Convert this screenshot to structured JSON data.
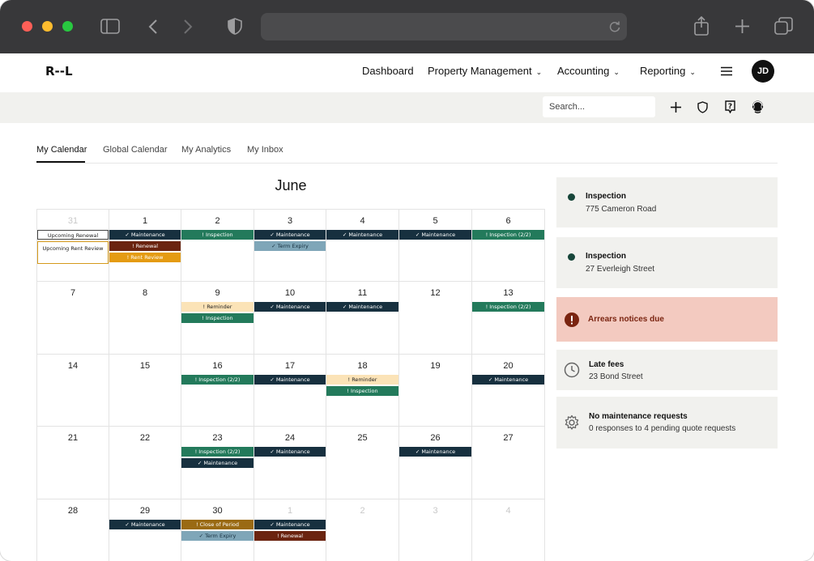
{
  "app": {
    "logo": "R--L",
    "nav": [
      {
        "label": "Dashboard",
        "has_menu": false
      },
      {
        "label": "Property Management",
        "has_menu": true
      },
      {
        "label": "Accounting",
        "has_menu": true
      },
      {
        "label": "Reporting",
        "has_menu": true
      }
    ],
    "user_initials": "JD"
  },
  "toolbar": {
    "search_placeholder": "Search...",
    "icons": [
      "plus-icon",
      "shield-icon",
      "help-icon",
      "support-icon"
    ]
  },
  "tabs": [
    {
      "label": "My Calendar",
      "active": true
    },
    {
      "label": "Global Calendar",
      "active": false
    },
    {
      "label": "My Analytics",
      "active": false
    },
    {
      "label": "My Inbox",
      "active": false
    }
  ],
  "calendar": {
    "month": "June",
    "weeks": [
      [
        {
          "day": "31",
          "muted": true,
          "events": [
            {
              "label": "Upcoming Renewal",
              "type": "outline"
            },
            {
              "label": "Upcoming Rent Review",
              "type": "outline-orange"
            }
          ]
        },
        {
          "day": "1",
          "events": [
            {
              "label": "✓ Maintenance",
              "type": "maintenance"
            },
            {
              "label": "! Renewal",
              "type": "renewal"
            },
            {
              "label": "! Rent Review",
              "type": "rentreview"
            }
          ]
        },
        {
          "day": "2",
          "events": [
            {
              "label": "! Inspection",
              "type": "inspection"
            }
          ]
        },
        {
          "day": "3",
          "events": [
            {
              "label": "✓ Maintenance",
              "type": "maintenance"
            },
            {
              "label": "✓ Term Expiry",
              "type": "termexpiry"
            }
          ]
        },
        {
          "day": "4",
          "events": [
            {
              "label": "✓ Maintenance",
              "type": "maintenance"
            }
          ]
        },
        {
          "day": "5",
          "events": [
            {
              "label": "✓ Maintenance",
              "type": "maintenance"
            }
          ]
        },
        {
          "day": "6",
          "events": [
            {
              "label": "! Inspection (2/2)",
              "type": "inspection"
            }
          ]
        }
      ],
      [
        {
          "day": "7",
          "events": []
        },
        {
          "day": "8",
          "events": []
        },
        {
          "day": "9",
          "events": [
            {
              "label": "! Reminder",
              "type": "reminder"
            },
            {
              "label": "! Inspection",
              "type": "inspection"
            }
          ]
        },
        {
          "day": "10",
          "events": [
            {
              "label": "✓ Maintenance",
              "type": "maintenance"
            }
          ]
        },
        {
          "day": "11",
          "events": [
            {
              "label": "✓ Maintenance",
              "type": "maintenance"
            }
          ]
        },
        {
          "day": "12",
          "events": []
        },
        {
          "day": "13",
          "events": [
            {
              "label": "! Inspection (2/2)",
              "type": "inspection"
            }
          ]
        }
      ],
      [
        {
          "day": "14",
          "events": []
        },
        {
          "day": "15",
          "events": []
        },
        {
          "day": "16",
          "events": [
            {
              "label": "! Inspection (2/2)",
              "type": "inspection"
            }
          ]
        },
        {
          "day": "17",
          "events": [
            {
              "label": "✓ Maintenance",
              "type": "maintenance"
            }
          ]
        },
        {
          "day": "18",
          "events": [
            {
              "label": "! Reminder",
              "type": "reminder"
            },
            {
              "label": "! Inspection",
              "type": "inspection"
            }
          ]
        },
        {
          "day": "19",
          "events": []
        },
        {
          "day": "20",
          "events": [
            {
              "label": "✓ Maintenance",
              "type": "maintenance"
            }
          ]
        }
      ],
      [
        {
          "day": "21",
          "events": []
        },
        {
          "day": "22",
          "events": []
        },
        {
          "day": "23",
          "events": [
            {
              "label": "! Inspection (2/2)",
              "type": "inspection"
            },
            {
              "label": "✓ Maintenance",
              "type": "maintenance"
            }
          ]
        },
        {
          "day": "24",
          "events": [
            {
              "label": "✓ Maintenance",
              "type": "maintenance"
            }
          ]
        },
        {
          "day": "25",
          "events": []
        },
        {
          "day": "26",
          "events": [
            {
              "label": "✓ Maintenance",
              "type": "maintenance"
            }
          ]
        },
        {
          "day": "27",
          "events": []
        }
      ],
      [
        {
          "day": "28",
          "events": []
        },
        {
          "day": "29",
          "events": [
            {
              "label": "✓ Maintenance",
              "type": "maintenance"
            }
          ]
        },
        {
          "day": "30",
          "events": [
            {
              "label": "! Close of Period",
              "type": "closeperiod"
            },
            {
              "label": "✓ Term Expiry",
              "type": "termexpiry"
            }
          ]
        },
        {
          "day": "1",
          "muted": true,
          "events": [
            {
              "label": "✓ Maintenance",
              "type": "maintenance"
            },
            {
              "label": "! Renewal",
              "type": "renewal"
            }
          ]
        },
        {
          "day": "2",
          "muted": true,
          "events": []
        },
        {
          "day": "3",
          "muted": true,
          "events": []
        },
        {
          "day": "4",
          "muted": true,
          "events": []
        }
      ]
    ]
  },
  "event_colors": {
    "maintenance": {
      "bg": "#17303f",
      "fg": "#ffffff"
    },
    "inspection": {
      "bg": "#237a5b",
      "fg": "#ffffff"
    },
    "renewal": {
      "bg": "#6b2410",
      "fg": "#ffffff"
    },
    "rentreview": {
      "bg": "#e49b12",
      "fg": "#ffffff"
    },
    "termexpiry": {
      "bg": "#7fa6b8",
      "fg": "#17303f"
    },
    "reminder": {
      "bg": "#fbe3b7",
      "fg": "#222222"
    },
    "closeperiod": {
      "bg": "#9a6a13",
      "fg": "#ffffff"
    }
  },
  "panel": [
    {
      "icon": "green-dot-icon",
      "title": "Inspection",
      "subtitle": "775 Cameron Road"
    },
    {
      "icon": "green-dot-icon",
      "title": "Inspection",
      "subtitle": "27 Everleigh Street"
    },
    {
      "icon": "alert-icon",
      "title": "Arrears notices due",
      "subtitle": "",
      "highlight": true
    },
    {
      "icon": "clock-icon",
      "title": "Late fees",
      "subtitle": "23 Bond Street"
    },
    {
      "icon": "gear-icon",
      "title": "No maintenance requests",
      "subtitle": "0 responses to 4 pending quote requests"
    }
  ],
  "colors": {
    "chrome_bg": "#38383a",
    "toolbar_bg": "#f1f1ee",
    "alert_bg": "#f3cac0",
    "alert_text": "#7a2410",
    "alert_icon": "#7a2410"
  }
}
